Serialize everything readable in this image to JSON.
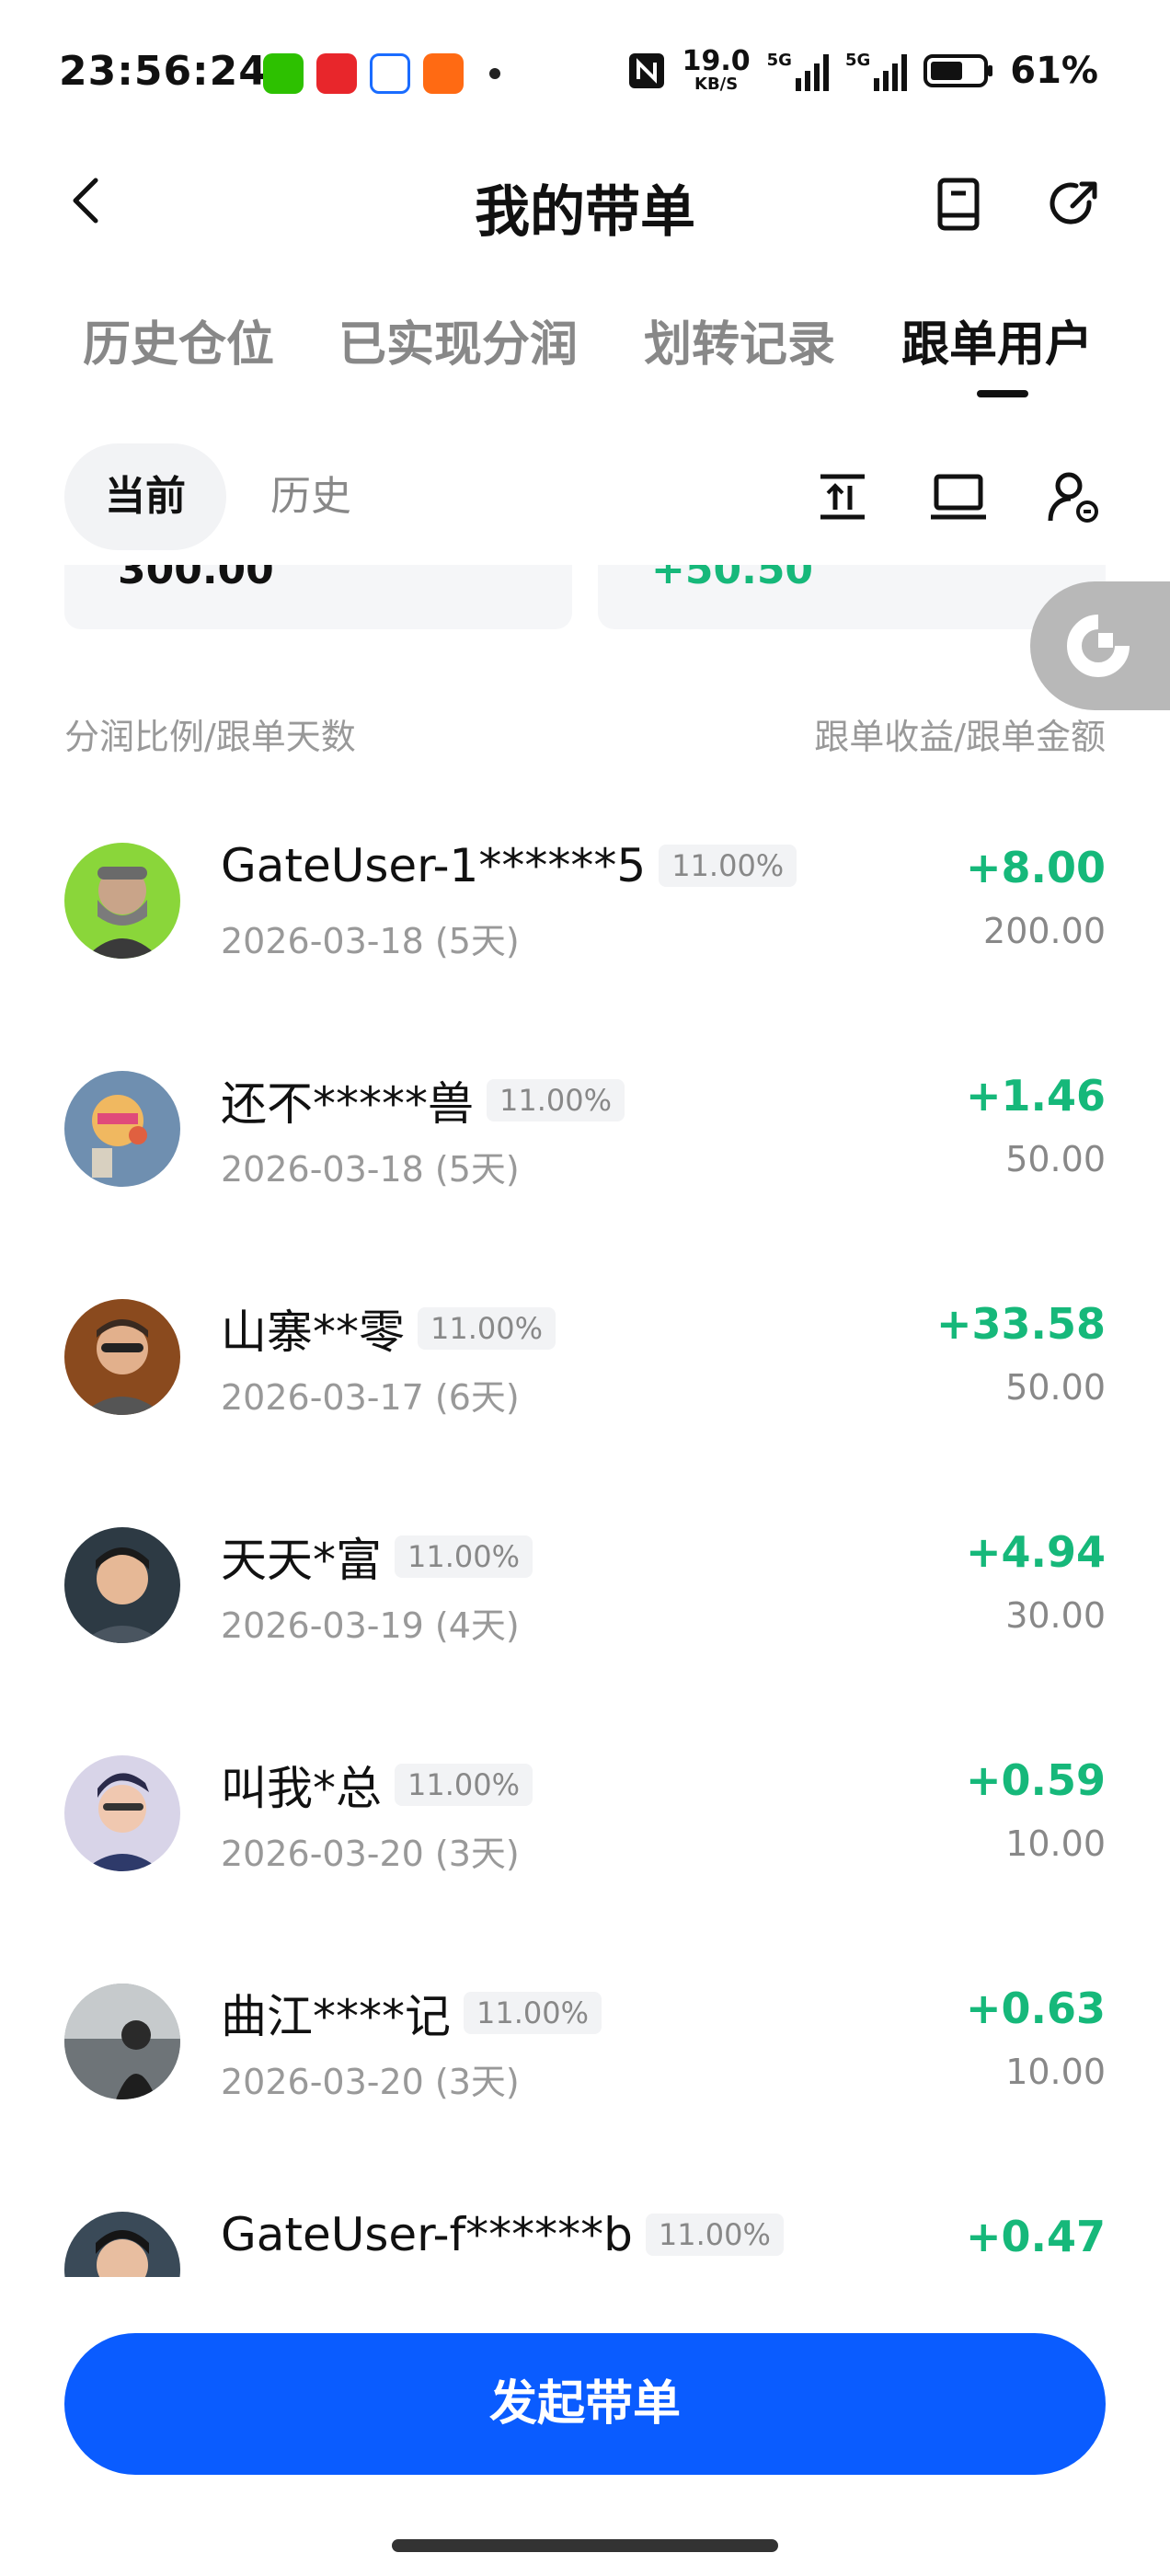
{
  "status_bar": {
    "time": "23:56:24",
    "net_speed": "19.0",
    "net_speed_unit": "KB/S",
    "signal1": "5G",
    "signal2": "5G",
    "battery": "61%",
    "app_icons": [
      "wechat-icon",
      "app-red-icon",
      "app-blue-icon",
      "app-orange-icon"
    ]
  },
  "header": {
    "title": "我的带单"
  },
  "tabs": [
    {
      "label": "历史仓位",
      "active": false
    },
    {
      "label": "已实现分润",
      "active": false
    },
    {
      "label": "划转记录",
      "active": false
    },
    {
      "label": "跟单用户",
      "active": true
    }
  ],
  "subtabs": [
    {
      "label": "当前",
      "active": true
    },
    {
      "label": "历史",
      "active": false
    }
  ],
  "summary_cards": [
    {
      "clipped_value": "300.00"
    },
    {
      "clipped_value": "+50.50"
    }
  ],
  "columns": {
    "left": "分润比例/跟单天数",
    "right": "跟单收益/跟单金额"
  },
  "followers": [
    {
      "name": "GateUser-1******5",
      "ratio": "11.00%",
      "date": "2026-03-18 (5天)",
      "profit": "+8.00",
      "amount": "200.00"
    },
    {
      "name": "还不*****兽",
      "ratio": "11.00%",
      "date": "2026-03-18 (5天)",
      "profit": "+1.46",
      "amount": "50.00"
    },
    {
      "name": "山寨**零",
      "ratio": "11.00%",
      "date": "2026-03-17 (6天)",
      "profit": "+33.58",
      "amount": "50.00"
    },
    {
      "name": "天天*富",
      "ratio": "11.00%",
      "date": "2026-03-19 (4天)",
      "profit": "+4.94",
      "amount": "30.00"
    },
    {
      "name": "叫我*总",
      "ratio": "11.00%",
      "date": "2026-03-20 (3天)",
      "profit": "+0.59",
      "amount": "10.00"
    },
    {
      "name": "曲江****记",
      "ratio": "11.00%",
      "date": "2026-03-20 (3天)",
      "profit": "+0.63",
      "amount": "10.00"
    },
    {
      "name": "GateUser-f******b",
      "ratio": "11.00%",
      "date": "",
      "profit": "+0.47",
      "amount": ""
    }
  ],
  "cta": {
    "label": "发起带单"
  },
  "colors": {
    "accent": "#0a5cff",
    "profit_green": "#16b87a",
    "muted": "#888888"
  }
}
